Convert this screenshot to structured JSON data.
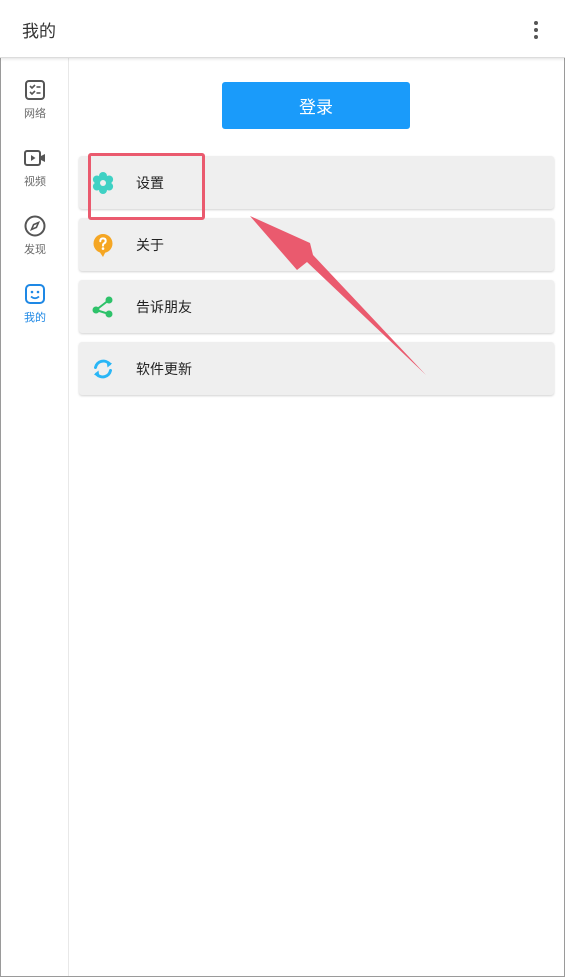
{
  "appbar": {
    "title": "我的",
    "more_icon": "more-vertical-icon"
  },
  "sidebar": {
    "items": [
      {
        "label": "网络",
        "icon": "network-checklist-icon",
        "active": false
      },
      {
        "label": "视频",
        "icon": "video-icon",
        "active": false
      },
      {
        "label": "发现",
        "icon": "compass-icon",
        "active": false
      },
      {
        "label": "我的",
        "icon": "smile-face-icon",
        "active": true
      }
    ]
  },
  "main": {
    "login_label": "登录",
    "menu": [
      {
        "label": "设置",
        "icon": "settings-gear-icon",
        "icon_color": "#3fd1c4"
      },
      {
        "label": "关于",
        "icon": "question-bubble-icon",
        "icon_color": "#f5a623"
      },
      {
        "label": "告诉朋友",
        "icon": "share-icon",
        "icon_color": "#2ec26a"
      },
      {
        "label": "软件更新",
        "icon": "refresh-icon",
        "icon_color": "#29b6f6"
      }
    ]
  },
  "colors": {
    "accent": "#1a9bfa",
    "active_nav": "#1e88e5",
    "annotation": "#ea5a6e"
  }
}
